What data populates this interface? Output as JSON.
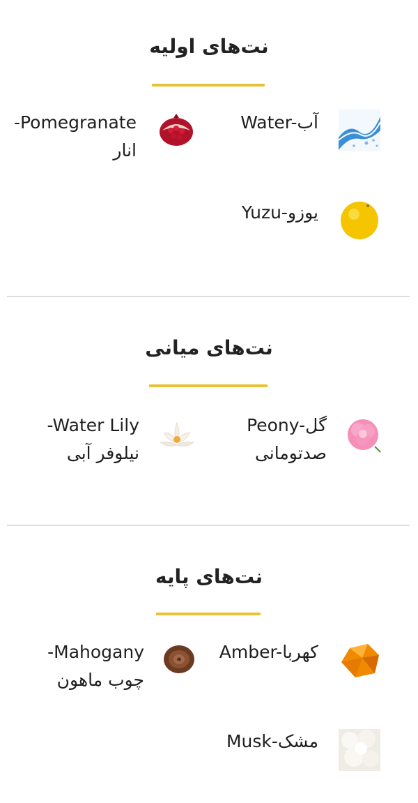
{
  "sections": [
    {
      "title": "نت‌های اولیه",
      "notes": [
        {
          "text": "Water-آب",
          "icon": "water-splash-icon"
        },
        {
          "text_line1": "-Pomegranate",
          "text_line2": "انار",
          "icon": "pomegranate-icon"
        },
        {
          "text": "Yuzu-یوزو",
          "icon": "yuzu-icon"
        }
      ]
    },
    {
      "title": "نت‌های میانی",
      "notes": [
        {
          "text_line1": "Peony-گل",
          "text_line2": "صدتومانی",
          "icon": "peony-flower-icon"
        },
        {
          "text_line1": "-Water Lily",
          "text_line2": "نیلوفر آبی",
          "icon": "water-lily-icon"
        }
      ]
    },
    {
      "title": "نت‌های پایه",
      "notes": [
        {
          "text": "Amber-کهربا",
          "icon": "amber-stone-icon"
        },
        {
          "text_line1": "-Mahogany",
          "text_line2": "چوب ماهون",
          "icon": "mahogany-wood-icon"
        },
        {
          "text": "Musk-مشک",
          "icon": "musk-cotton-icon"
        }
      ]
    }
  ],
  "colors": {
    "accent_underline": "#e8c136",
    "divider": "#dedede",
    "text": "#222222"
  }
}
